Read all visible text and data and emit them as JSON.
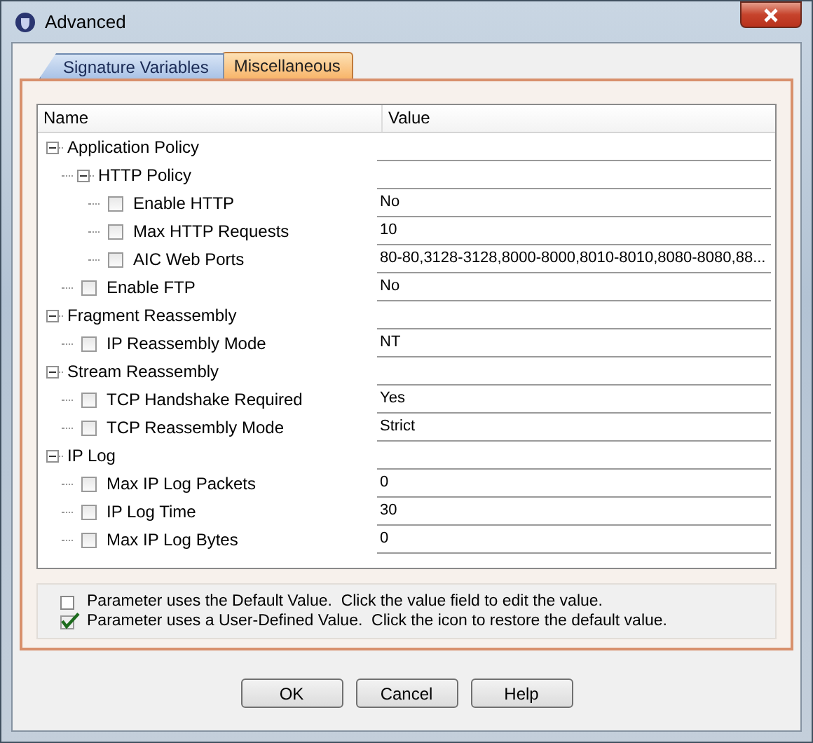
{
  "window": {
    "title": "Advanced"
  },
  "tabs": [
    {
      "label": "Signature Variables",
      "selected": false
    },
    {
      "label": "Miscellaneous",
      "selected": true
    }
  ],
  "table": {
    "columns": [
      "Name",
      "Value"
    ],
    "rows": [
      {
        "name": "Application Policy",
        "expanded": true,
        "children": [
          {
            "name": "HTTP Policy",
            "expanded": true,
            "children": [
              {
                "name": "Enable HTTP",
                "checked": false,
                "value": "No"
              },
              {
                "name": "Max HTTP Requests",
                "checked": false,
                "value": "10"
              },
              {
                "name": "AIC Web Ports",
                "checked": false,
                "value": "80-80,3128-3128,8000-8000,8010-8010,8080-8080,88..."
              }
            ]
          },
          {
            "name": "Enable FTP",
            "checked": false,
            "value": "No"
          }
        ]
      },
      {
        "name": "Fragment Reassembly",
        "expanded": true,
        "children": [
          {
            "name": "IP Reassembly Mode",
            "checked": false,
            "value": "NT"
          }
        ]
      },
      {
        "name": "Stream Reassembly",
        "expanded": true,
        "children": [
          {
            "name": "TCP Handshake Required",
            "checked": false,
            "value": "Yes"
          },
          {
            "name": "TCP Reassembly Mode",
            "checked": false,
            "value": "Strict"
          }
        ]
      },
      {
        "name": "IP Log",
        "expanded": true,
        "children": [
          {
            "name": "Max IP Log Packets",
            "checked": false,
            "value": "0"
          },
          {
            "name": "IP Log Time",
            "checked": false,
            "value": "30"
          },
          {
            "name": "Max IP Log Bytes",
            "checked": false,
            "value": "0"
          }
        ]
      }
    ]
  },
  "legend": [
    {
      "text": "Parameter uses the Default Value.  Click the value field to edit the value.",
      "checked": false
    },
    {
      "text": "Parameter uses a User-Defined Value.  Click the icon to restore the default value.",
      "checked": true
    }
  ],
  "buttons": [
    "OK",
    "Cancel",
    "Help"
  ]
}
